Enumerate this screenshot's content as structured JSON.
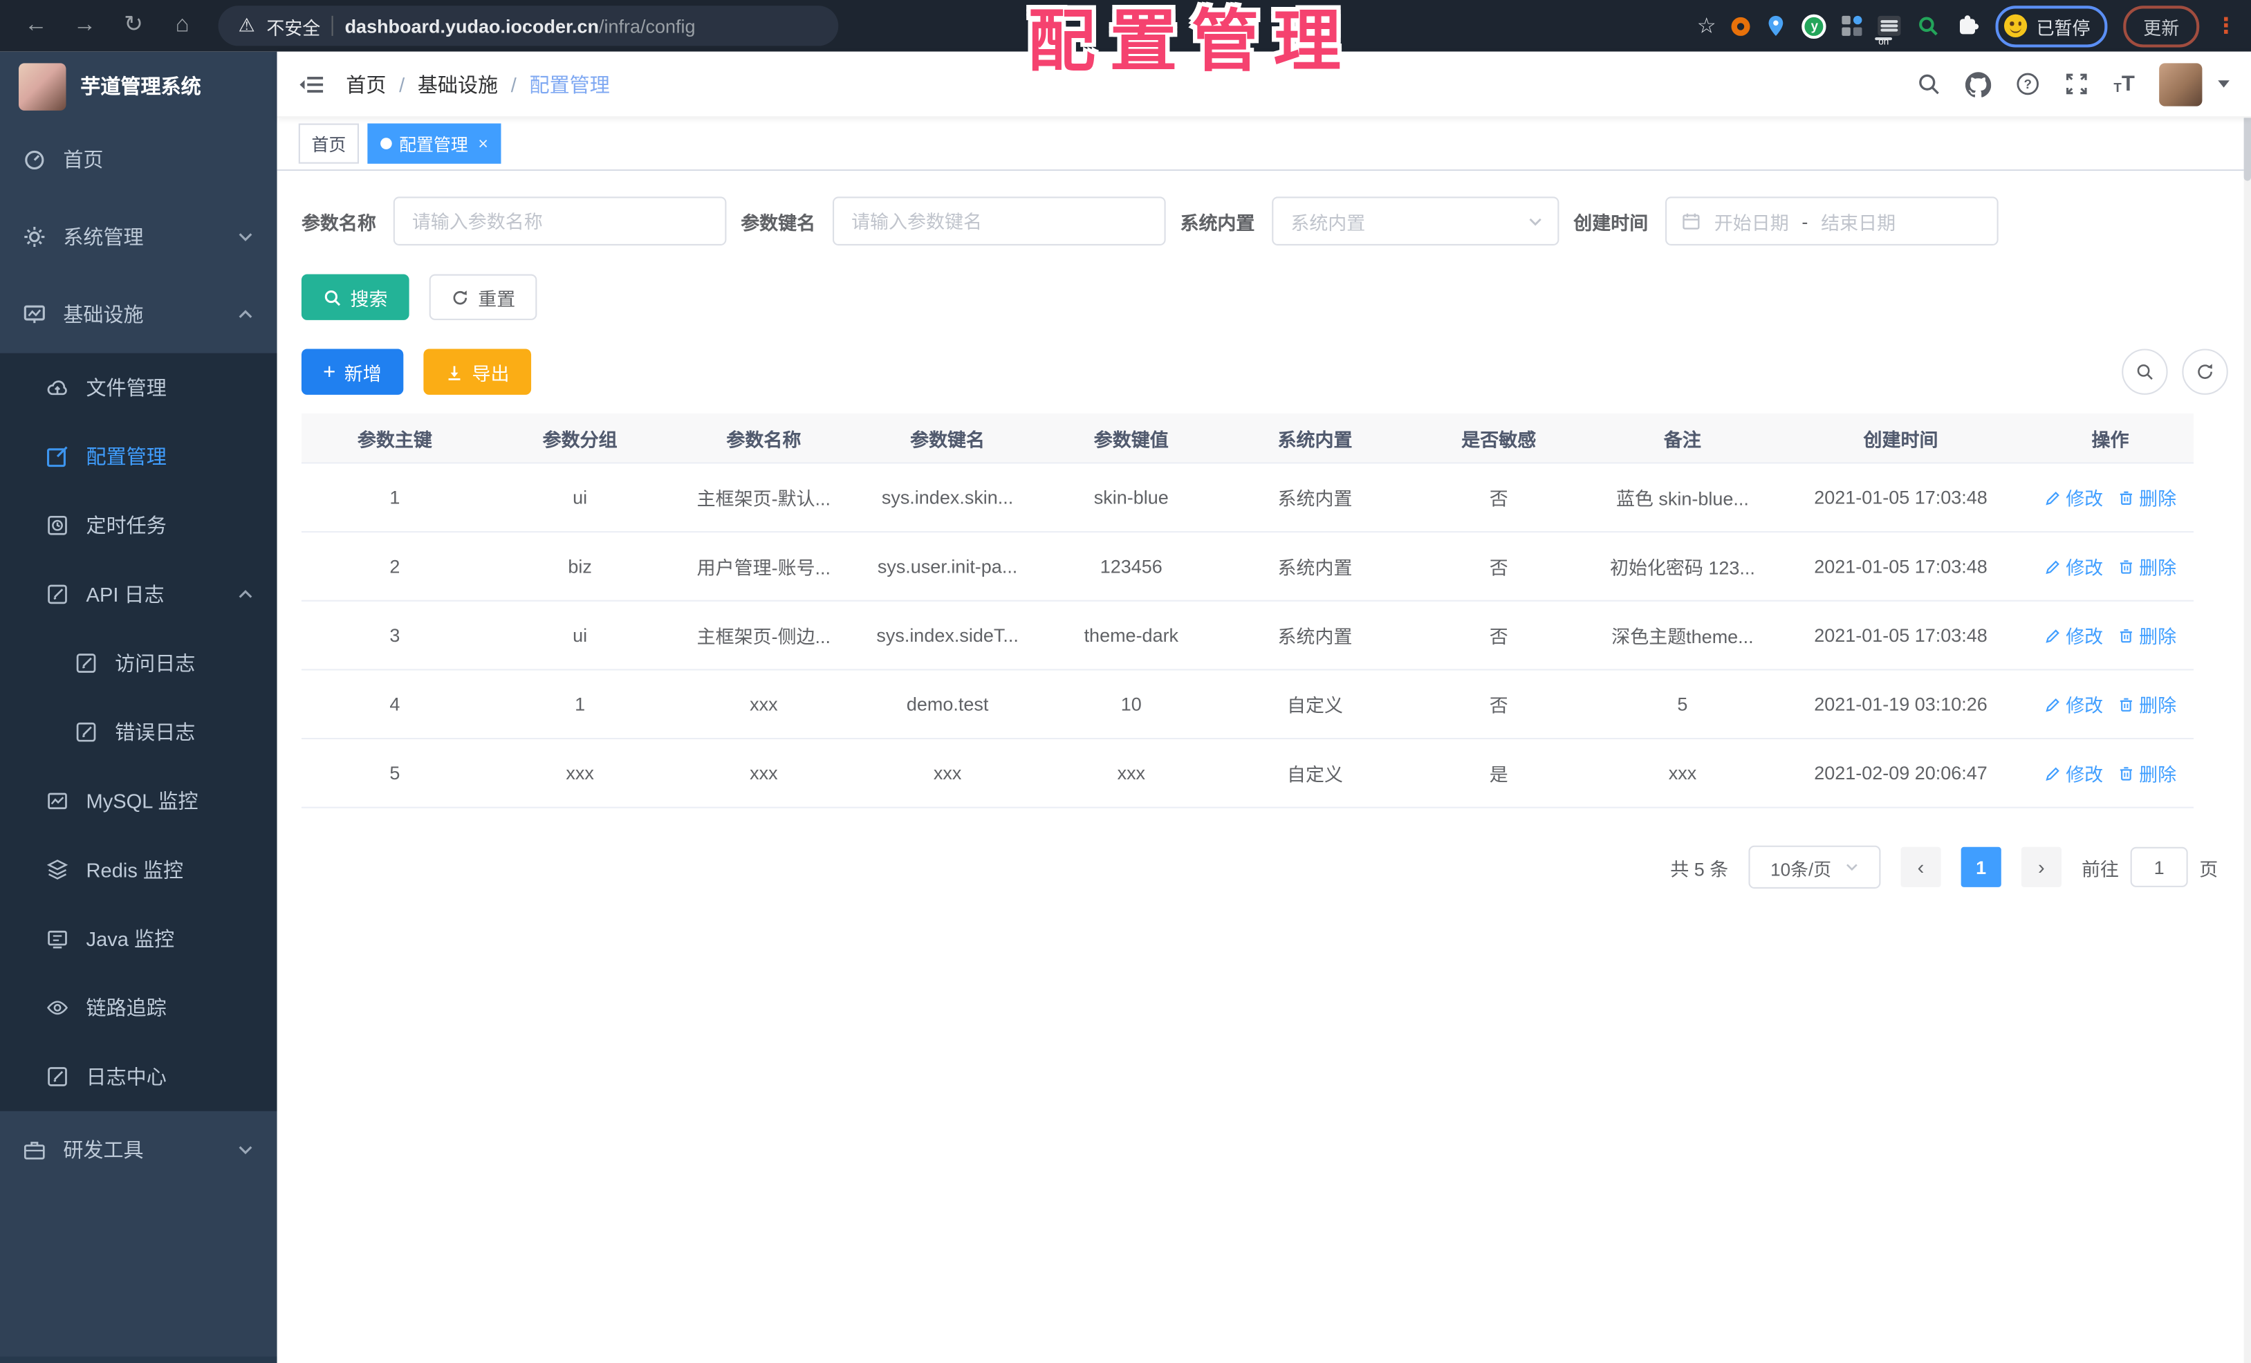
{
  "overlay_title": "配置管理",
  "browser": {
    "security_label": "不安全",
    "url_host": "dashboard.yudao.iocoder.cn",
    "url_path": "/infra/config",
    "paused_label": "已暂停",
    "update_label": "更新",
    "icons": {
      "back": "←",
      "forward": "→",
      "reload": "↻",
      "home": "⌂",
      "warning": "⚠",
      "star": "☆",
      "menu_dots": "⋮",
      "on_badge": "on",
      "ext_y": "y"
    }
  },
  "app": {
    "title": "芋道管理系统",
    "breadcrumb": {
      "items": [
        "首页",
        "基础设施",
        "配置管理"
      ],
      "separator": "/"
    },
    "tabs": [
      {
        "label": "首页"
      },
      {
        "label": "配置管理",
        "close": "×"
      }
    ]
  },
  "sidebar": {
    "items": [
      {
        "label": "首页"
      },
      {
        "label": "系统管理"
      },
      {
        "label": "基础设施"
      },
      {
        "label": "文件管理"
      },
      {
        "label": "配置管理"
      },
      {
        "label": "定时任务"
      },
      {
        "label": "API 日志"
      },
      {
        "label": "访问日志"
      },
      {
        "label": "错误日志"
      },
      {
        "label": "MySQL 监控"
      },
      {
        "label": "Redis 监控"
      },
      {
        "label": "Java 监控"
      },
      {
        "label": "链路追踪"
      },
      {
        "label": "日志中心"
      },
      {
        "label": "研发工具"
      }
    ]
  },
  "filters": {
    "name_label": "参数名称",
    "name_placeholder": "请输入参数名称",
    "key_label": "参数键名",
    "key_placeholder": "请输入参数键名",
    "type_label": "系统内置",
    "type_placeholder": "系统内置",
    "date_label": "创建时间",
    "date_start_placeholder": "开始日期",
    "date_separator": "-",
    "date_end_placeholder": "结束日期"
  },
  "toolbar": {
    "search_label": "搜索",
    "reset_label": "重置",
    "add_label": "新增",
    "export_label": "导出",
    "plus_glyph": "+"
  },
  "table": {
    "headers": [
      "参数主键",
      "参数分组",
      "参数名称",
      "参数键名",
      "参数键值",
      "系统内置",
      "是否敏感",
      "备注",
      "创建时间",
      "操作"
    ],
    "edit_label": "修改",
    "delete_label": "删除",
    "rows": [
      {
        "cells": [
          "1",
          "ui",
          "主框架页-默认...",
          "sys.index.skin...",
          "skin-blue",
          "系统内置",
          "否",
          "蓝色 skin-blue...",
          "2021-01-05 17:03:48"
        ]
      },
      {
        "cells": [
          "2",
          "biz",
          "用户管理-账号...",
          "sys.user.init-pa...",
          "123456",
          "系统内置",
          "否",
          "初始化密码 123...",
          "2021-01-05 17:03:48"
        ]
      },
      {
        "cells": [
          "3",
          "ui",
          "主框架页-侧边...",
          "sys.index.sideT...",
          "theme-dark",
          "系统内置",
          "否",
          "深色主题theme...",
          "2021-01-05 17:03:48"
        ]
      },
      {
        "cells": [
          "4",
          "1",
          "xxx",
          "demo.test",
          "10",
          "自定义",
          "否",
          "5",
          "2021-01-19 03:10:26"
        ]
      },
      {
        "cells": [
          "5",
          "xxx",
          "xxx",
          "xxx",
          "xxx",
          "自定义",
          "是",
          "xxx",
          "2021-02-09 20:06:47"
        ]
      }
    ]
  },
  "pagination": {
    "total_text": "共 5 条",
    "page_size": "10条/页",
    "prev": "‹",
    "next": "›",
    "current_page": "1",
    "goto_label": "前往",
    "goto_value": "1",
    "page_unit": "页"
  },
  "colors": {
    "accent": "#409eff",
    "sidebar_bg": "#304156",
    "submenu_bg": "#1f2d3d",
    "search_button": "#23b397",
    "add_button": "#2080f0",
    "export_button": "#fbad15",
    "overlay_title": "#f5426f",
    "active_tab": "#409eff"
  }
}
